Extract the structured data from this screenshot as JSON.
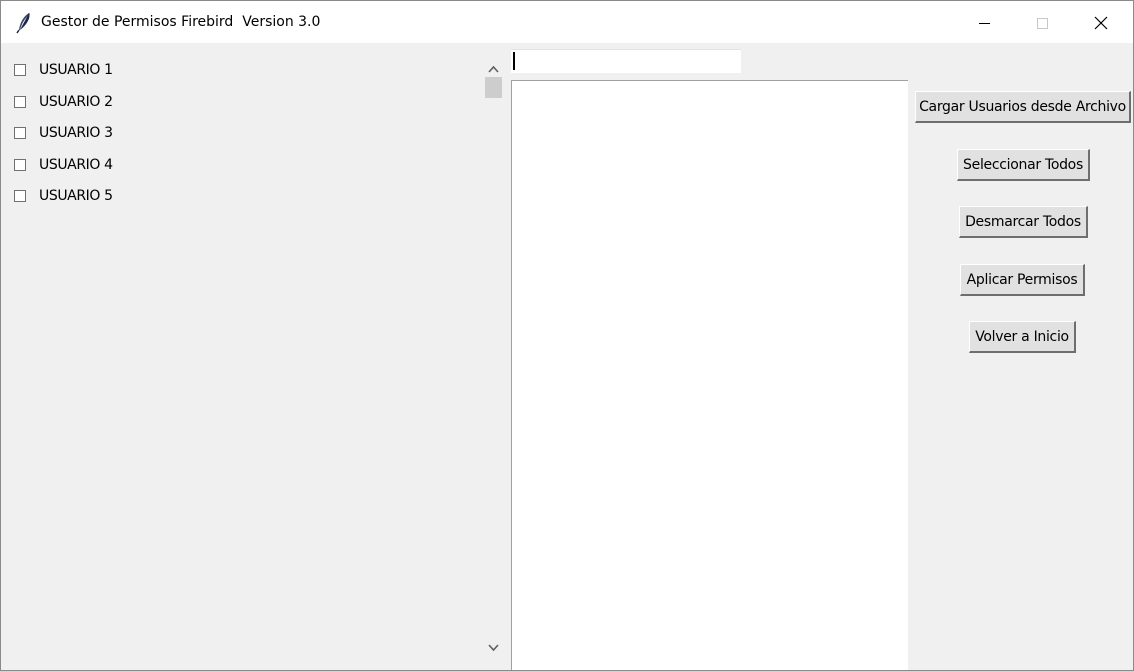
{
  "window": {
    "title": "Gestor de Permisos Firebird  Version 3.0"
  },
  "users": [
    {
      "label": "USUARIO 1",
      "checked": false
    },
    {
      "label": "USUARIO 2",
      "checked": false
    },
    {
      "label": "USUARIO 3",
      "checked": false
    },
    {
      "label": "USUARIO 4",
      "checked": false
    },
    {
      "label": "USUARIO 5",
      "checked": false
    }
  ],
  "search": {
    "value": ""
  },
  "actions": {
    "load_label": "Cargar Usuarios desde Archivo",
    "select_all_label": "Seleccionar Todos",
    "deselect_all_label": "Desmarcar Todos",
    "apply_label": "Aplicar Permisos",
    "back_label": "Volver a Inicio"
  },
  "icons": {
    "app": "feather-icon",
    "minimize": "minimize-icon",
    "maximize": "maximize-icon",
    "close": "close-icon",
    "scroll_up": "chevron-up-icon",
    "scroll_down": "chevron-down-icon"
  },
  "colors": {
    "window_bg": "#f0f0f0",
    "titlebar_bg": "#ffffff",
    "button_bg": "#e1e1e1"
  }
}
